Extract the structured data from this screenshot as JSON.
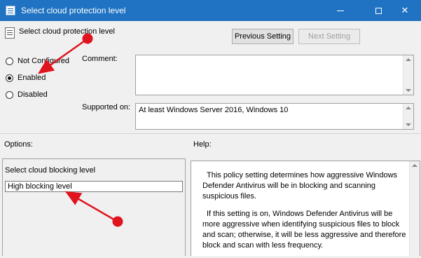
{
  "window": {
    "title": "Select cloud protection level",
    "app_icon": "policy-icon",
    "controls": [
      "minimize-icon",
      "maximize-icon",
      "close-icon"
    ]
  },
  "header": {
    "policy_name": "Select cloud protection level",
    "prev_button": "Previous Setting",
    "next_button": "Next Setting",
    "next_enabled": false
  },
  "state": {
    "options": [
      {
        "label": "Not Configured",
        "checked": false
      },
      {
        "label": "Enabled",
        "checked": true
      },
      {
        "label": "Disabled",
        "checked": false
      }
    ]
  },
  "comment": {
    "label": "Comment:",
    "value": ""
  },
  "supported": {
    "label": "Supported on:",
    "value": "At least Windows Server 2016, Windows 10"
  },
  "options_panel": {
    "label": "Options:",
    "field_label": "Select cloud blocking level",
    "selected_value": "High blocking level"
  },
  "help_panel": {
    "label": "Help:",
    "paragraph1": "This policy setting determines how aggressive Windows Defender Antivirus will be in blocking and scanning suspicious files.",
    "paragraph2": "If this setting is on, Windows Defender Antivirus will be more aggressive when identifying suspicious files to block and scan; otherwise, it will be less aggressive and therefore block and scan with less frequency."
  },
  "annotation_color": "#e0141e"
}
